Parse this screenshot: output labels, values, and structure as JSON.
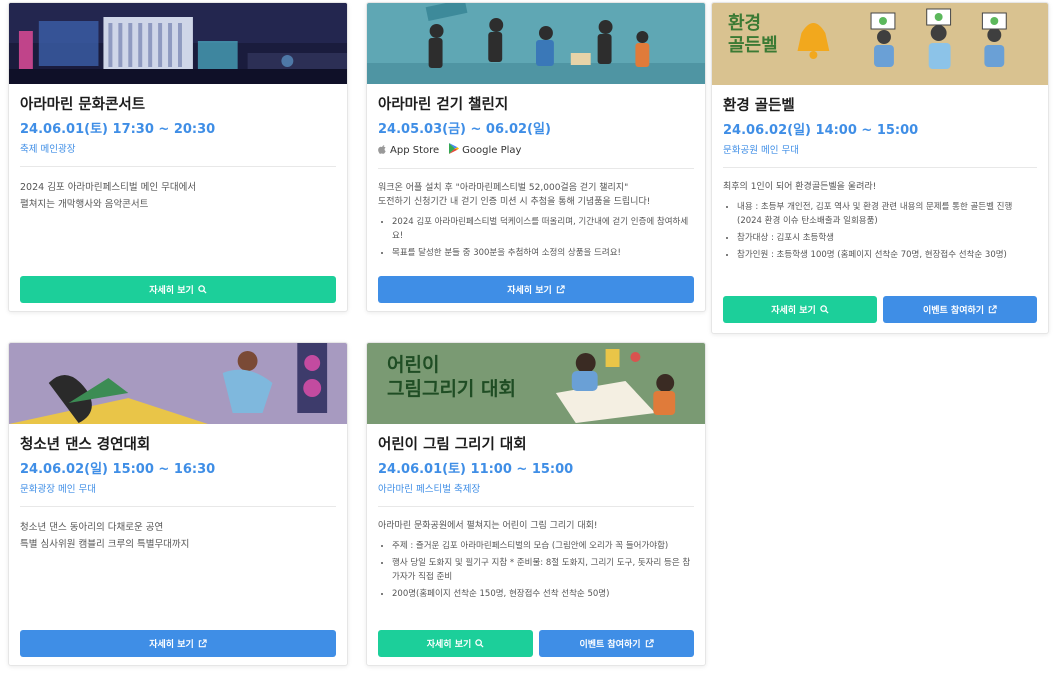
{
  "colors": {
    "accent_blue": "#3f8ee6",
    "accent_green": "#1ccf9a"
  },
  "cards": [
    {
      "title": "아라마린 문화콘서트",
      "date": "24.06.01(토) 17:30 ~ 20:30",
      "place": "축제 메인광장",
      "desc_lines": [
        "2024 김포 아라마린페스티벌 메인 무대에서",
        "펼쳐지는 개막행사와 음악콘서트"
      ],
      "buttons": [
        {
          "label": "자세히 보기",
          "icon": "search-icon"
        }
      ]
    },
    {
      "title": "아라마린 걷기 챌린지",
      "date": "24.05.03(금) ~ 06.02(일)",
      "store": {
        "appstore": "App Store",
        "googleplay": "Google Play"
      },
      "desc_lines": [
        "워크온 어플 설치 후 \"아라마린페스티벌 52,000걸음 걷기 챌리지\"",
        "도전하기 신청기간 내 걷기 인증 미션 시 추첨을 통해 기념품을 드립니다!"
      ],
      "bullets": [
        "2024 김포 아라마린페스티벌 덕케이스를 떠올리며, 기간내에 걷기 인증에 참여하세요!",
        "목표를 달성한 분들 중 300분을 추첨하여 소정의 상품을 드려요!"
      ],
      "buttons": [
        {
          "label": "자세히 보기",
          "icon": "external-link-icon"
        }
      ]
    },
    {
      "title": "환경 골든벨",
      "date": "24.06.02(일) 14:00 ~ 15:00",
      "place": "문화공원 메인 무대",
      "banner_text": [
        "환경",
        "골든벨"
      ],
      "desc_lines": [
        "최후의 1인이 되어 환경골든벨을 울려라!"
      ],
      "bullets": [
        "내용 : 초등부 개인전, 김포 역사 및 환경 관련 내용의 문제를 통한 골든벨 진행 (2024 환경 이슈 탄소배출과 일회용품)",
        "참가대상 : 김포시 초등학생",
        "참가인원 : 초등학생 100명 (홈페이지 선착순 70명, 현장접수 선착순 30명)"
      ],
      "buttons": [
        {
          "label": "자세히 보기",
          "icon": "search-icon"
        },
        {
          "label": "이벤트 참여하기",
          "icon": "external-link-icon"
        }
      ]
    },
    {
      "title": "청소년 댄스 경연대회",
      "date": "24.06.02(일) 15:00 ~ 16:30",
      "place": "문화광장 메인 무대",
      "desc_lines": [
        "청소년 댄스 동아리의 다채로운 공연",
        "특별 심사위원 캠블리 크루의 특별무대까지"
      ],
      "buttons": [
        {
          "label": "자세히 보기",
          "icon": "external-link-icon"
        }
      ]
    },
    {
      "title": "어린이 그림 그리기 대회",
      "date": "24.06.01(토) 11:00 ~ 15:00",
      "place": "아라마린 페스티벌 축제장",
      "banner_text": [
        "어린이",
        "그림그리기 대회"
      ],
      "desc_lines": [
        "아라마린 문화공원에서 펼쳐지는 어린이 그림 그리기 대회!"
      ],
      "bullets": [
        "주제 : 즐거운 김포 아라마린페스티벌의 모습 (그림안에 오리가 꼭 들어가야함)",
        "행사 당일 도화지 및 필기구 지참 * 준비물: 8절 도화지, 그리기 도구, 돗자리 등은 참가자가 직접 준비",
        "200명(홈페이지 선착순 150명, 현장접수 선착 선착순 50명)"
      ],
      "buttons": [
        {
          "label": "자세히 보기",
          "icon": "search-icon"
        },
        {
          "label": "이벤트 참여하기",
          "icon": "external-link-icon"
        }
      ]
    }
  ]
}
